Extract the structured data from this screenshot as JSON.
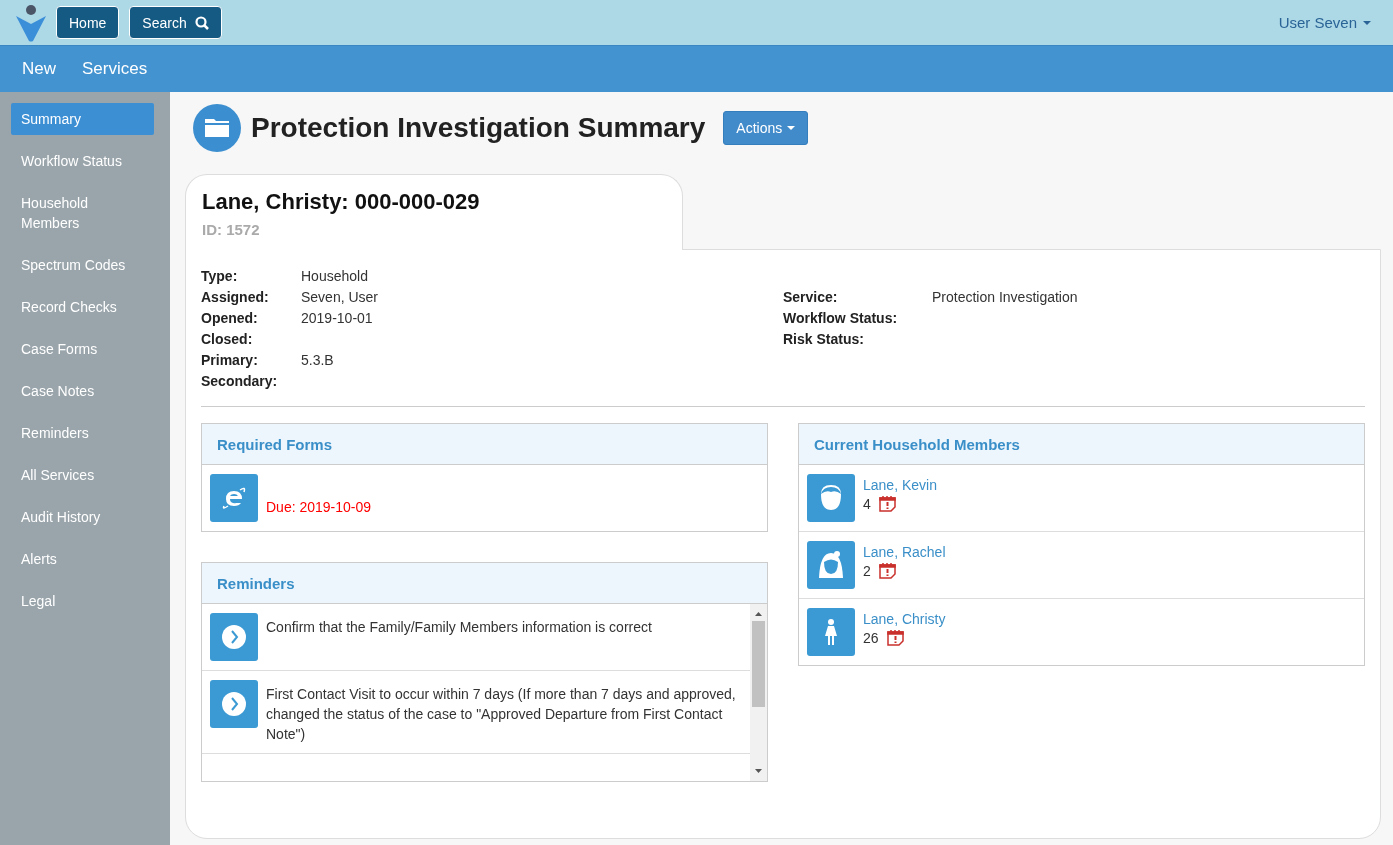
{
  "topbar": {
    "buttons": [
      {
        "label": "Home",
        "kind": "plain"
      },
      {
        "label": "Search",
        "kind": "search"
      }
    ],
    "user": "User Seven"
  },
  "navbar": {
    "items": [
      "New",
      "Services"
    ]
  },
  "sidebar": {
    "items": [
      {
        "label": "Summary",
        "selected": true
      },
      {
        "label": "Workflow Status",
        "selected": false
      },
      {
        "label": "Household Members",
        "selected": false
      },
      {
        "label": "Spectrum Codes",
        "selected": false
      },
      {
        "label": "Record Checks",
        "selected": false
      },
      {
        "label": "Case Forms",
        "selected": false
      },
      {
        "label": "Case Notes",
        "selected": false
      },
      {
        "label": "Reminders",
        "selected": false
      },
      {
        "label": "All Services",
        "selected": false
      },
      {
        "label": "Audit History",
        "selected": false
      },
      {
        "label": "Alerts",
        "selected": false
      },
      {
        "label": "Legal",
        "selected": false
      }
    ]
  },
  "page": {
    "title": "Protection Investigation Summary",
    "actions": "Actions"
  },
  "case": {
    "name": "Lane, Christy: 000-000-029",
    "id": "ID: 1572",
    "left_fields": [
      {
        "label": "Type:",
        "value": "Household"
      },
      {
        "label": "Assigned:",
        "value": "Seven, User"
      },
      {
        "label": "Opened:",
        "value": "2019-10-01"
      },
      {
        "label": "Closed:"
      },
      {
        "label": "Primary:",
        "value": "5.3.B"
      },
      {
        "label": "Secondary:"
      }
    ],
    "right_fields": [
      {
        "label": "Service:",
        "value": "Protection Investigation"
      },
      {
        "label": "Workflow Status:"
      },
      {
        "label": "Risk Status:"
      }
    ]
  },
  "required_forms": {
    "title": "Required Forms",
    "items": [
      {
        "due": "Due: 2019-10-09",
        "overdue": true
      }
    ]
  },
  "reminders": {
    "title": "Reminders",
    "items": [
      "Confirm that the Family/Family Members information is correct",
      "First Contact Visit to occur within 7 days (If more than 7 days and approved, changed the status of the case to \"Approved Departure from First Contact Note\")"
    ]
  },
  "household": {
    "title": "Current Household Members",
    "members": [
      {
        "name": "Lane, Kevin",
        "age": "4",
        "kind": "boy"
      },
      {
        "name": "Lane, Rachel",
        "age": "2",
        "kind": "girl"
      },
      {
        "name": "Lane, Christy",
        "age": "26",
        "kind": "woman"
      }
    ]
  }
}
